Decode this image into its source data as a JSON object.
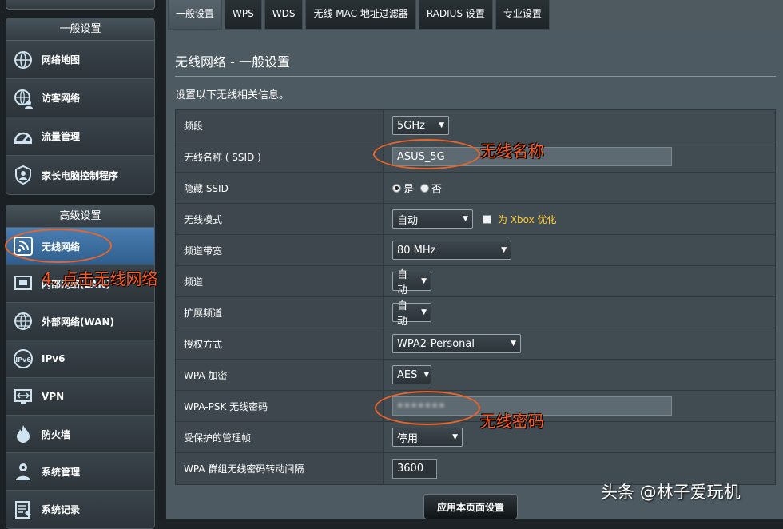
{
  "sidebar": {
    "general_title": "一般设置",
    "general_items": [
      {
        "label": "网络地图",
        "icon": "network-map-icon"
      },
      {
        "label": "访客网络",
        "icon": "guest-network-icon"
      },
      {
        "label": "流量管理",
        "icon": "traffic-gauge-icon"
      },
      {
        "label": "家长电脑控制程序",
        "icon": "parental-control-icon"
      }
    ],
    "advanced_title": "高级设置",
    "advanced_items": [
      {
        "label": "无线网络",
        "icon": "wireless-icon",
        "active": true
      },
      {
        "label": "内部网络(LAN)",
        "icon": "lan-icon"
      },
      {
        "label": "外部网络(WAN)",
        "icon": "wan-globe-icon"
      },
      {
        "label": "IPv6",
        "icon": "ipv6-icon"
      },
      {
        "label": "VPN",
        "icon": "vpn-icon"
      },
      {
        "label": "防火墙",
        "icon": "firewall-icon"
      },
      {
        "label": "系统管理",
        "icon": "system-admin-icon"
      },
      {
        "label": "系统记录",
        "icon": "system-log-icon"
      }
    ]
  },
  "tabs": [
    "一般设置",
    "WPS",
    "WDS",
    "无线 MAC 地址过滤器",
    "RADIUS 设置",
    "专业设置"
  ],
  "active_tab": 0,
  "page": {
    "title": "无线网络 - 一般设置",
    "description": "设置以下无线相关信息。"
  },
  "settings": {
    "band": {
      "label": "频段",
      "value": "5GHz"
    },
    "ssid": {
      "label": "无线名称 ( SSID )",
      "value": "ASUS_5G"
    },
    "hide_ssid": {
      "label": "隐藏 SSID",
      "yes": "是",
      "no": "否",
      "selected": "yes"
    },
    "wireless_mode": {
      "label": "无线模式",
      "value": "自动",
      "xbox_label": "为 Xbox 优化"
    },
    "bandwidth": {
      "label": "频道带宽",
      "value": "80 MHz"
    },
    "channel": {
      "label": "频道",
      "value": "自动"
    },
    "ext_channel": {
      "label": "扩展频道",
      "value": "自动"
    },
    "auth": {
      "label": "授权方式",
      "value": "WPA2-Personal"
    },
    "wpa_enc": {
      "label": "WPA 加密",
      "value": "AES"
    },
    "psk": {
      "label": "WPA-PSK 无线密码",
      "value": "•••••••"
    },
    "pmf": {
      "label": "受保护的管理帧",
      "value": "停用"
    },
    "rekey": {
      "label": "WPA 群组无线密码转动间隔",
      "value": "3600"
    }
  },
  "apply_label": "应用本页面设置",
  "annotations": {
    "ssid_note": "无线名称",
    "password_note": "无线密码",
    "step_note": "4. 点击无线网络"
  },
  "watermark": "头条 @林子爱玩机",
  "colors": {
    "annotation": "#e8642a",
    "active_item": "#3a6c9d",
    "xbox_label": "#ffcc33"
  }
}
